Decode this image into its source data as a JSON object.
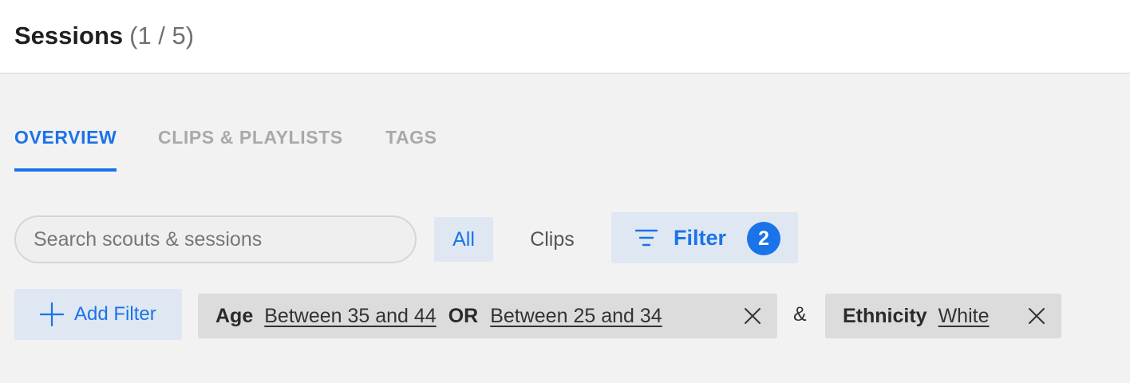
{
  "header": {
    "title": "Sessions",
    "count": "(1 / 5)"
  },
  "tabs": [
    {
      "label": "OVERVIEW",
      "active": true
    },
    {
      "label": "CLIPS & PLAYLISTS",
      "active": false
    },
    {
      "label": "TAGS",
      "active": false
    }
  ],
  "toolbar": {
    "search_placeholder": "Search scouts & sessions",
    "search_value": "",
    "segments": [
      {
        "label": "All",
        "selected": true
      },
      {
        "label": "Clips",
        "selected": false
      }
    ],
    "filter_label": "Filter",
    "filter_count": "2",
    "filter_icon": "filter-lines-icon"
  },
  "filters": {
    "add_label": "Add Filter",
    "add_icon": "plus-icon",
    "joiner": "&",
    "chips": [
      {
        "key": "Age",
        "values": [
          "Between 35 and 44",
          "Between 25 and 34"
        ],
        "operator": "OR"
      },
      {
        "key": "Ethnicity",
        "values": [
          "White"
        ]
      }
    ]
  },
  "colors": {
    "accent": "#1a73e8",
    "accent_bg": "#dfe7f2",
    "chip_bg": "#dcdcdc",
    "page_bg": "#f2f2f2"
  }
}
